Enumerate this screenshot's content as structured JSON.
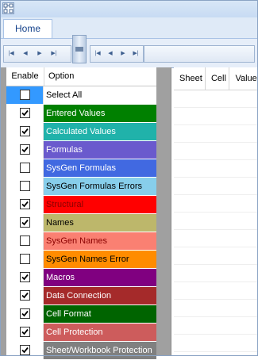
{
  "ribbon": {
    "tabs": [
      {
        "label": "Home"
      }
    ]
  },
  "navigators": [
    {
      "buttons": [
        "first-icon",
        "prev-icon",
        "next-icon",
        "last-icon"
      ]
    },
    {
      "buttons": [
        "first-icon",
        "prev-icon",
        "next-icon",
        "last-icon"
      ]
    }
  ],
  "options_grid": {
    "headers": {
      "enable": "Enable",
      "option": "Option"
    },
    "rows": [
      {
        "label": "Select All",
        "checked": false,
        "color": "#ffffff",
        "text_color": "#000000",
        "selected_cell": true
      },
      {
        "label": "Entered Values",
        "checked": true,
        "color": "#008000",
        "text_color": "#ffffff"
      },
      {
        "label": "Calculated Values",
        "checked": true,
        "color": "#20b2aa",
        "text_color": "#ffffff"
      },
      {
        "label": "Formulas",
        "checked": true,
        "color": "#6a5acd",
        "text_color": "#ffffff"
      },
      {
        "label": "SysGen Formulas",
        "checked": false,
        "color": "#4169e1",
        "text_color": "#ffffff"
      },
      {
        "label": "SysGen Formulas Errors",
        "checked": false,
        "color": "#87ceeb",
        "text_color": "#000000"
      },
      {
        "label": "Structural",
        "checked": true,
        "color": "#ff0000",
        "text_color": "#8b0000"
      },
      {
        "label": "Names",
        "checked": true,
        "color": "#bdb76b",
        "text_color": "#000000"
      },
      {
        "label": "SysGen Names",
        "checked": false,
        "color": "#fa8072",
        "text_color": "#8b0000"
      },
      {
        "label": "SysGen Names Error",
        "checked": false,
        "color": "#ff8c00",
        "text_color": "#000000"
      },
      {
        "label": "Macros",
        "checked": true,
        "color": "#800080",
        "text_color": "#ffffff"
      },
      {
        "label": "Data Connection",
        "checked": true,
        "color": "#a52a2a",
        "text_color": "#ffffff"
      },
      {
        "label": "Cell Format",
        "checked": true,
        "color": "#006400",
        "text_color": "#ffffff"
      },
      {
        "label": "Cell Protection",
        "checked": true,
        "color": "#cd5c5c",
        "text_color": "#ffffff"
      },
      {
        "label": "Sheet/Workbook Protection",
        "checked": true,
        "color": "#808080",
        "text_color": "#ffffff"
      }
    ]
  },
  "results_grid": {
    "columns": [
      "Sheet",
      "Cell",
      "Value"
    ]
  },
  "colors": {
    "accent": "#a9c3e6",
    "selection": "#3399ff"
  }
}
